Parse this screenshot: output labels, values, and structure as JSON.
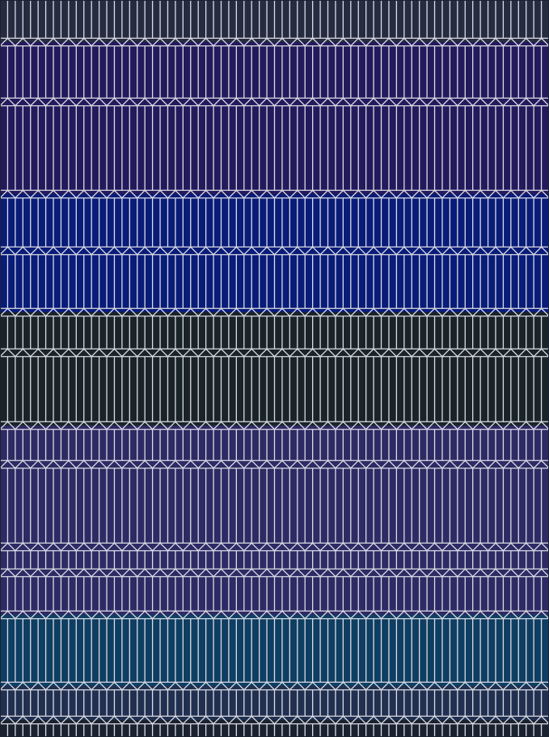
{
  "pattern": {
    "description_hidden": "",
    "line_color": "#dcdce6",
    "bands": [
      {
        "color": "#262c40"
      },
      {
        "color": "#231a5c"
      },
      {
        "color": "#231a5c"
      },
      {
        "color": "#081c78"
      },
      {
        "color": "#081c78"
      },
      {
        "color": "#1a2428"
      },
      {
        "color": "#1a2428"
      },
      {
        "color": "#2e2a64"
      },
      {
        "color": "#2e2a64"
      },
      {
        "color": "#2e2a64"
      },
      {
        "color": "#2e2a64"
      },
      {
        "color": "#0e3e62"
      },
      {
        "color": "#213050"
      },
      {
        "color": "#1a2230"
      }
    ]
  }
}
